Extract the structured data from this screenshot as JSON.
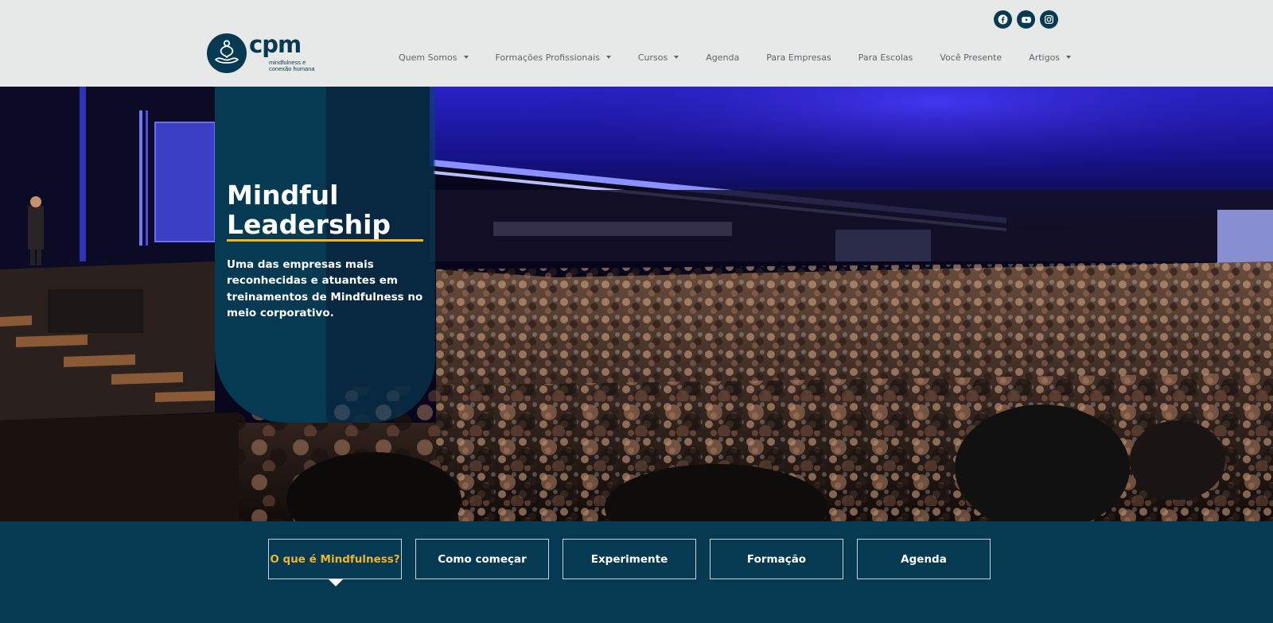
{
  "social": [
    {
      "name": "facebook-icon"
    },
    {
      "name": "youtube-icon"
    },
    {
      "name": "instagram-icon"
    }
  ],
  "logo": {
    "wordmark": "cpm",
    "tagline_line1": "mindfulness e",
    "tagline_line2": "conexão humana"
  },
  "nav": {
    "items": [
      {
        "label": "Quem Somos",
        "dropdown": true
      },
      {
        "label": "Formações Profissionais",
        "dropdown": true
      },
      {
        "label": "Cursos",
        "dropdown": true
      },
      {
        "label": "Agenda",
        "dropdown": false
      },
      {
        "label": "Para Empresas",
        "dropdown": false
      },
      {
        "label": "Para Escolas",
        "dropdown": false
      },
      {
        "label": "Você Presente",
        "dropdown": false
      },
      {
        "label": "Artigos",
        "dropdown": true
      }
    ]
  },
  "hero": {
    "title_line1": "Mindful",
    "title_line2": "Leadership",
    "subtitle": "Uma das empresas mais reconhecidas e atuantes em treinamentos de Mindfulness no meio corporativo."
  },
  "tabs": {
    "items": [
      {
        "label": "O que é Mindfulness?",
        "active": true
      },
      {
        "label": "Como começar",
        "active": false
      },
      {
        "label": "Experimente",
        "active": false
      },
      {
        "label": "Formação",
        "active": false
      },
      {
        "label": "Agenda",
        "active": false
      }
    ]
  },
  "colors": {
    "brand_navy": "#063a52",
    "accent_gold": "#f0b429",
    "header_bg": "#e7e9e8",
    "nav_text": "#5d6468"
  }
}
